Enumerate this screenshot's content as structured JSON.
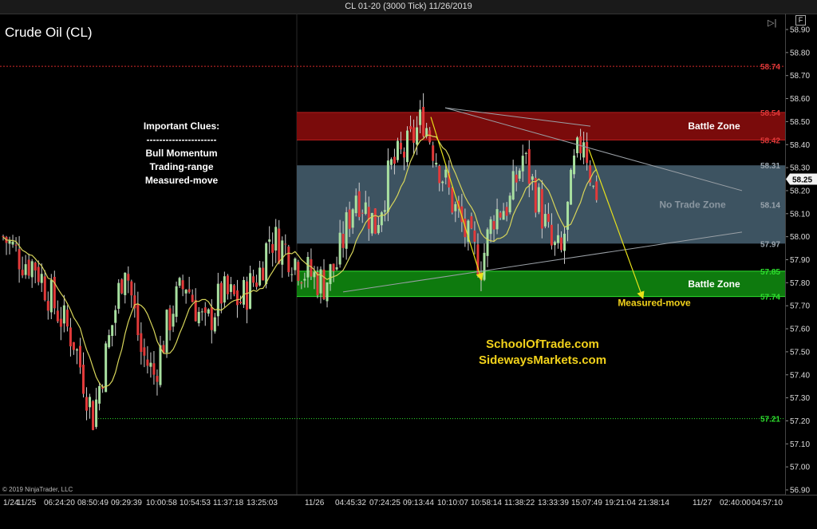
{
  "window_title": "CL 01-20 (3000 Tick)  11/26/2019",
  "instrument": "Crude Oil (CL)",
  "copyright": "© 2019 NinjaTrader, LLC",
  "buttons": {
    "scroll_end_icon": "▷|",
    "f_label": "F"
  },
  "clues": [
    "Important Clues:",
    "----------------------",
    "Bull Momentum",
    "Trading-range",
    "Measured-move"
  ],
  "sites": [
    "SchoolOfTrade.com",
    "SidewaysMarkets.com"
  ],
  "colors": {
    "up_candle": "#a8e0a0",
    "down_candle": "#e23a3a",
    "wick": "#cfcfcf",
    "battle_zone_top": "#7a0b0b",
    "battle_zone_bottom": "#0e7a0e",
    "no_trade_zone": "#3d5361",
    "ma_line": "#d7d55a",
    "arrow": "#e8e21a",
    "annotation_yellow": "#f2d21b"
  },
  "chart_data": {
    "type": "candlestick",
    "ylim": [
      56.9,
      58.9
    ],
    "y_ticks": [
      58.9,
      58.8,
      58.7,
      58.6,
      58.5,
      58.4,
      58.3,
      58.2,
      58.1,
      58.0,
      57.9,
      57.8,
      57.7,
      57.6,
      57.5,
      57.4,
      57.3,
      57.2,
      57.1,
      57.0,
      56.9
    ],
    "x_tick_labels": [
      "1/24",
      "11/25",
      "06:24:20",
      "08:50:49",
      "09:29:39",
      "10:00:58",
      "10:54:53",
      "11:37:18",
      "13:25:03",
      "11/26",
      "04:45:32",
      "07:24:25",
      "09:13:44",
      "10:10:07",
      "10:58:14",
      "11:38:22",
      "13:33:39",
      "15:07:49",
      "19:21:04",
      "21:38:14",
      "11/27",
      "02:40:00",
      "04:57:10"
    ],
    "current_price": "58.25",
    "levels": [
      {
        "label": "58.74",
        "value": 58.74,
        "color": "#e23a3a",
        "style": "dotted-line"
      },
      {
        "label": "58.54",
        "value": 58.54,
        "color": "#e23a3a"
      },
      {
        "label": "58.42",
        "value": 58.42,
        "color": "#e23a3a"
      },
      {
        "label": "58.31",
        "value": 58.31,
        "color": "#9aa4ad"
      },
      {
        "label": "58.14",
        "value": 58.14,
        "color": "#9aa4ad"
      },
      {
        "label": "57.97",
        "value": 57.97,
        "color": "#9aa4ad"
      },
      {
        "label": "57.85",
        "value": 57.85,
        "color": "#2ee02e"
      },
      {
        "label": "57.74",
        "value": 57.74,
        "color": "#2ee02e"
      },
      {
        "label": "57.21",
        "value": 57.21,
        "color": "#2ee02e",
        "style": "dotted-line"
      }
    ],
    "zones": [
      {
        "label": "Battle Zone",
        "from": 58.42,
        "to": 58.54
      },
      {
        "label": "No Trade Zone",
        "from": 57.97,
        "to": 58.31
      },
      {
        "label": "Battle Zone",
        "from": 57.74,
        "to": 57.85
      }
    ],
    "annotations": {
      "measured_move": "Measured-move"
    },
    "anchors": [
      [
        0,
        58.0
      ],
      [
        6,
        57.9
      ],
      [
        10,
        57.88
      ],
      [
        16,
        57.7
      ],
      [
        22,
        57.55
      ],
      [
        28,
        57.22
      ],
      [
        33,
        57.55
      ],
      [
        38,
        57.9
      ],
      [
        43,
        57.5
      ],
      [
        47,
        57.4
      ],
      [
        53,
        57.7
      ],
      [
        57,
        57.8
      ],
      [
        63,
        57.6
      ],
      [
        68,
        57.75
      ],
      [
        74,
        57.72
      ],
      [
        80,
        57.85
      ],
      [
        83,
        58.0
      ],
      [
        88,
        57.95
      ],
      [
        94,
        57.85
      ],
      [
        100,
        57.8
      ],
      [
        104,
        57.88
      ],
      [
        110,
        58.2
      ],
      [
        116,
        58.05
      ],
      [
        121,
        58.3
      ],
      [
        126,
        58.38
      ],
      [
        131,
        58.52
      ],
      [
        135,
        58.35
      ],
      [
        140,
        58.15
      ],
      [
        146,
        57.95
      ],
      [
        149,
        57.88
      ],
      [
        153,
        58.1
      ],
      [
        158,
        58.15
      ],
      [
        162,
        58.35
      ],
      [
        167,
        58.15
      ],
      [
        171,
        57.95
      ],
      [
        174,
        57.92
      ],
      [
        178,
        58.3
      ],
      [
        181,
        58.45
      ],
      [
        184,
        58.2
      ]
    ]
  }
}
